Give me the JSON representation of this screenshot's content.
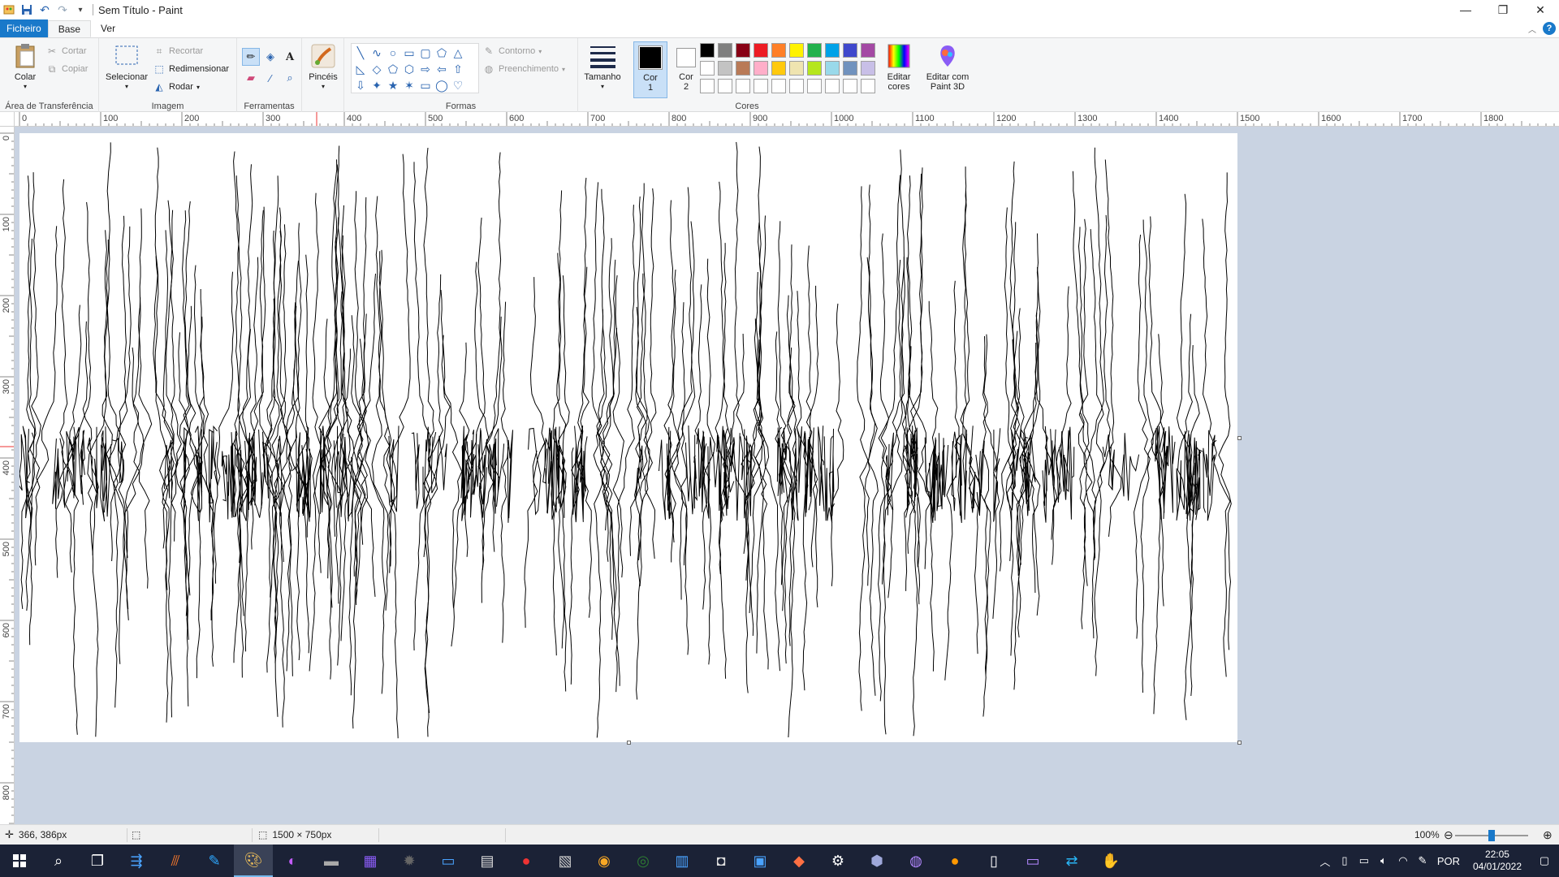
{
  "window": {
    "title": "Sem Título - Paint",
    "qat": [
      "save-icon",
      "undo-icon",
      "redo-icon",
      "customize-icon"
    ],
    "controls": {
      "minimize": "—",
      "maximize": "❐",
      "close": "✕"
    }
  },
  "tabs": {
    "file": "Ficheiro",
    "home": "Base",
    "view": "Ver"
  },
  "ribbon": {
    "clipboard": {
      "label": "Área de Transferência",
      "paste": "Colar",
      "cut": "Cortar",
      "copy": "Copiar"
    },
    "image": {
      "label": "Imagem",
      "select": "Selecionar",
      "crop": "Recortar",
      "resize": "Redimensionar",
      "rotate": "Rodar"
    },
    "tools": {
      "label": "Ferramentas"
    },
    "brushes": {
      "label": "Pincéis"
    },
    "shapes": {
      "label": "Formas",
      "outline": "Contorno",
      "fill": "Preenchimento"
    },
    "size": {
      "label": "Tamanho"
    },
    "colors": {
      "label": "Cores",
      "color1": "Cor\n1",
      "color1_a": "Cor",
      "color1_b": "1",
      "color2_a": "Cor",
      "color2_b": "2",
      "edit_colors_a": "Editar",
      "edit_colors_b": "cores",
      "paint3d_a": "Editar com",
      "paint3d_b": "Paint 3D",
      "palette_row1": [
        "#000000",
        "#7f7f7f",
        "#880015",
        "#ed1c24",
        "#ff7f27",
        "#fff200",
        "#22b14c",
        "#00a2e8",
        "#3f48cc",
        "#a349a4"
      ],
      "palette_row2": [
        "#ffffff",
        "#c3c3c3",
        "#b97a57",
        "#ffaec9",
        "#ffc90e",
        "#efe4b0",
        "#b5e61d",
        "#99d9ea",
        "#7092be",
        "#c8bfe7"
      ]
    }
  },
  "rulers": {
    "h_labels": [
      "0",
      "100",
      "200",
      "300",
      "400",
      "500",
      "600",
      "700",
      "800",
      "900",
      "1000",
      "1100",
      "1200",
      "1300",
      "1400",
      "1500",
      "1600",
      "1700",
      "1800"
    ],
    "v_labels": [
      "0",
      "100",
      "200",
      "300",
      "400",
      "500",
      "600",
      "700",
      "800"
    ]
  },
  "status": {
    "cursor_pos": "366, 386px",
    "canvas_size": "1500 × 750px",
    "zoom": "100%",
    "zoom_level": 0.5
  },
  "taskbar": {
    "lang": "POR",
    "time": "22:05",
    "date": "04/01/2022"
  }
}
